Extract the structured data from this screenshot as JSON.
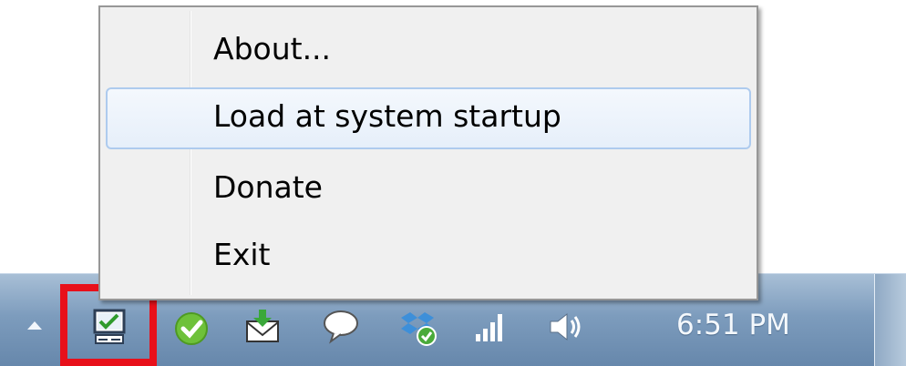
{
  "menu": {
    "items": [
      {
        "label": "About..."
      },
      {
        "label": "Load at system startup"
      },
      {
        "label": "Donate"
      },
      {
        "label": "Exit"
      }
    ],
    "hovered_index": 1
  },
  "taskbar": {
    "clock": "6:51 PM",
    "tray_icons": [
      "show-hidden-icons-arrow",
      "app-checklist-icon",
      "green-check-icon",
      "mail-download-icon",
      "speech-bubble-icon",
      "dropbox-icon",
      "network-signal-icon",
      "volume-icon"
    ]
  },
  "highlight_color": "#e8101a"
}
